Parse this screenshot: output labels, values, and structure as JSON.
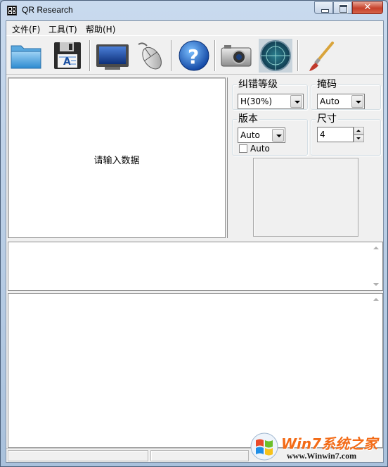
{
  "window": {
    "title": "QR Research",
    "close_glyph": "✕"
  },
  "menu": {
    "items": [
      "文件(F)",
      "工具(T)",
      "帮助(H)"
    ]
  },
  "toolbar": {
    "icons": [
      "folder-icon",
      "floppy-save-icon",
      "monitor-icon",
      "mouse-icon",
      "help-icon",
      "camera-icon",
      "radar-icon",
      "brush-icon"
    ]
  },
  "input_pane": {
    "placeholder_message": "请输入数据"
  },
  "settings": {
    "error_correction": {
      "label": "纠错等级",
      "value": "H(30%)"
    },
    "mask": {
      "label": "掩码",
      "value": "Auto"
    },
    "version": {
      "label": "版本",
      "value": "Auto",
      "auto_checkbox_label": "Auto",
      "auto_checked": false
    },
    "size": {
      "label": "尺寸",
      "value": "4"
    }
  },
  "watermark": {
    "brand": "Win7系统之家",
    "url": "www.Winwin7.com"
  }
}
